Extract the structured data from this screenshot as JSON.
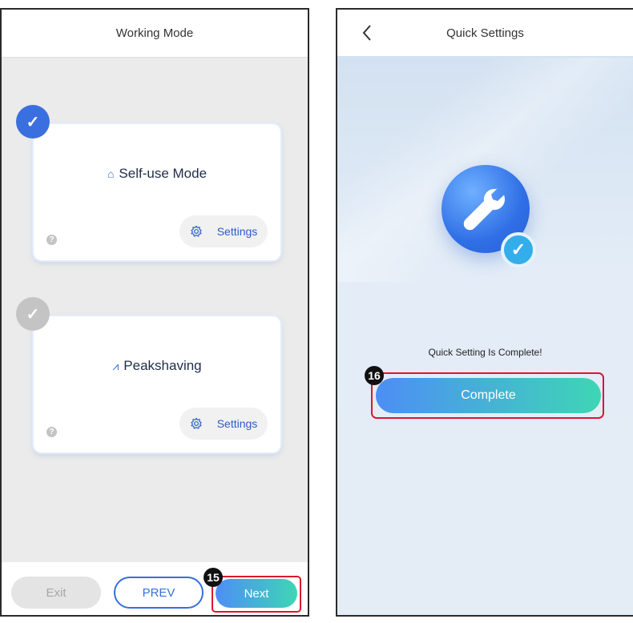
{
  "working_mode_screen": {
    "title": "Working Mode",
    "modes": [
      {
        "name": "Self-use Mode",
        "selected": true,
        "icon": "house-icon",
        "settings_label": "Settings"
      },
      {
        "name": "Peakshaving",
        "selected": false,
        "icon": "peak-icon",
        "settings_label": "Settings"
      }
    ],
    "footer": {
      "exit_label": "Exit",
      "prev_label": "PREV",
      "next_label": "Next",
      "step_number": "15"
    }
  },
  "quick_settings_screen": {
    "title": "Quick Settings",
    "message": "Quick Setting Is Complete!",
    "complete_label": "Complete",
    "step_number": "16"
  },
  "colors": {
    "accent_blue": "#3570d8",
    "gradient_start": "#4d8ef5",
    "gradient_end": "#3ed6b5",
    "highlight_red": "#d9182e"
  }
}
